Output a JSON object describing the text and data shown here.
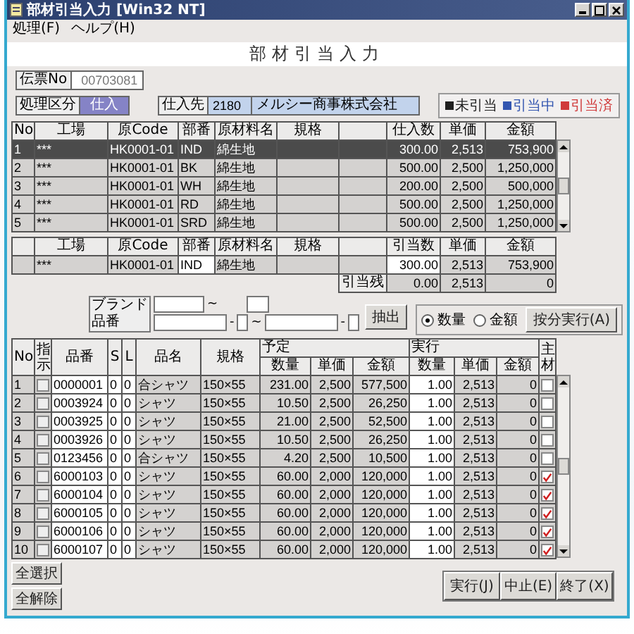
{
  "window": {
    "title": "部材引当入力 [Win32 NT]"
  },
  "menu": [
    "処理(F)",
    "ヘルプ(H)"
  ],
  "form_title": "部材引当入力",
  "slip_no": {
    "label": "伝票No",
    "value": "00703081"
  },
  "process_type": {
    "label": "処理区分",
    "value": "仕入"
  },
  "supplier": {
    "label": "仕入先",
    "code": "2180",
    "name": "メルシー商事株式会社"
  },
  "legend": [
    {
      "label": "未引当",
      "color": "#202020"
    },
    {
      "label": "引当中",
      "color": "#3356b0"
    },
    {
      "label": "引当済",
      "color": "#d03a3a"
    }
  ],
  "purchase_table": {
    "columns": [
      "No",
      "工場",
      "原Code",
      "部番",
      "原材料名",
      "規格",
      "仕入数",
      "単価",
      "金額"
    ],
    "rows": [
      {
        "no": "1",
        "factory": "***",
        "code": "HK0001-01",
        "part": "IND",
        "material": "綿生地",
        "qty": "300.00",
        "price": "2,513",
        "amount": "753,900",
        "selected": true
      },
      {
        "no": "2",
        "factory": "***",
        "code": "HK0001-01",
        "part": "BK",
        "material": "綿生地",
        "qty": "500.00",
        "price": "2,500",
        "amount": "1,250,000",
        "selected": false
      },
      {
        "no": "3",
        "factory": "***",
        "code": "HK0001-01",
        "part": "WH",
        "material": "綿生地",
        "qty": "200.00",
        "price": "2,500",
        "amount": "500,000",
        "selected": false
      },
      {
        "no": "4",
        "factory": "***",
        "code": "HK0001-01",
        "part": "RD",
        "material": "綿生地",
        "qty": "500.00",
        "price": "2,500",
        "amount": "1,250,000",
        "selected": false
      },
      {
        "no": "5",
        "factory": "***",
        "code": "HK0001-01",
        "part": "SRD",
        "material": "綿生地",
        "qty": "500.00",
        "price": "2,500",
        "amount": "1,250,000",
        "selected": false
      }
    ]
  },
  "allocation_table": {
    "columns": [
      "工場",
      "原Code",
      "部番",
      "原材料名",
      "規格",
      "引当数",
      "単価",
      "金額"
    ],
    "row": {
      "factory": "***",
      "code": "HK0001-01",
      "part": "IND",
      "material": "綿生地",
      "qty": "300.00",
      "price": "2,513",
      "amount": "753,900"
    }
  },
  "remaining": {
    "label": "引当残",
    "qty": "0.00",
    "price": "2,513",
    "amount": "0"
  },
  "filter": {
    "brand_label": "ブランド",
    "brand_sep": "~",
    "part_label": "品番",
    "part_seps": [
      "-",
      "~",
      "-"
    ]
  },
  "extract_button": "抽出",
  "mode": [
    {
      "label": "数量",
      "selected": true
    },
    {
      "label": "金額",
      "selected": false
    }
  ],
  "distribute_button": "按分実行(A)",
  "detail_table": {
    "columns": [
      "No",
      "指示",
      "品番",
      "S",
      "L",
      "品名",
      "規格"
    ],
    "plan_label": "予定",
    "exec_label": "実行",
    "plan_sub_columns": [
      "数量",
      "単価",
      "金額"
    ],
    "exec_sub_columns": [
      "数量",
      "単価",
      "金額"
    ],
    "main_label": "主材",
    "rows": [
      {
        "no": "1",
        "instructed": false,
        "part_no": "0000001",
        "s": "0",
        "l": "0",
        "name": "合シャツ",
        "spec": "150×55",
        "plan_qty": "231.00",
        "plan_price": "2,500",
        "plan_amount": "577,500",
        "exec_qty": "1.00",
        "exec_price": "2,513",
        "exec_amount": "0",
        "main_material": false
      },
      {
        "no": "2",
        "instructed": false,
        "part_no": "0003924",
        "s": "0",
        "l": "0",
        "name": "シャツ",
        "spec": "150×55",
        "plan_qty": "10.50",
        "plan_price": "2,500",
        "plan_amount": "26,250",
        "exec_qty": "1.00",
        "exec_price": "2,513",
        "exec_amount": "0",
        "main_material": false
      },
      {
        "no": "3",
        "instructed": false,
        "part_no": "0003925",
        "s": "0",
        "l": "0",
        "name": "シャツ",
        "spec": "150×55",
        "plan_qty": "21.00",
        "plan_price": "2,500",
        "plan_amount": "52,500",
        "exec_qty": "1.00",
        "exec_price": "2,513",
        "exec_amount": "0",
        "main_material": false
      },
      {
        "no": "4",
        "instructed": false,
        "part_no": "0003926",
        "s": "0",
        "l": "0",
        "name": "シャツ",
        "spec": "150×55",
        "plan_qty": "10.50",
        "plan_price": "2,500",
        "plan_amount": "26,250",
        "exec_qty": "1.00",
        "exec_price": "2,513",
        "exec_amount": "0",
        "main_material": false
      },
      {
        "no": "5",
        "instructed": false,
        "part_no": "0123456",
        "s": "0",
        "l": "0",
        "name": "合シャツ",
        "spec": "150×55",
        "plan_qty": "4.20",
        "plan_price": "2,500",
        "plan_amount": "10,500",
        "exec_qty": "1.00",
        "exec_price": "2,513",
        "exec_amount": "0",
        "main_material": false
      },
      {
        "no": "6",
        "instructed": false,
        "part_no": "6000103",
        "s": "0",
        "l": "0",
        "name": "シャツ",
        "spec": "150×55",
        "plan_qty": "60.00",
        "plan_price": "2,000",
        "plan_amount": "120,000",
        "exec_qty": "1.00",
        "exec_price": "2,513",
        "exec_amount": "0",
        "main_material": true
      },
      {
        "no": "7",
        "instructed": false,
        "part_no": "6000104",
        "s": "0",
        "l": "0",
        "name": "シャツ",
        "spec": "150×55",
        "plan_qty": "60.00",
        "plan_price": "2,000",
        "plan_amount": "120,000",
        "exec_qty": "1.00",
        "exec_price": "2,513",
        "exec_amount": "0",
        "main_material": true
      },
      {
        "no": "8",
        "instructed": false,
        "part_no": "6000105",
        "s": "0",
        "l": "0",
        "name": "シャツ",
        "spec": "150×55",
        "plan_qty": "60.00",
        "plan_price": "2,000",
        "plan_amount": "120,000",
        "exec_qty": "1.00",
        "exec_price": "2,513",
        "exec_amount": "0",
        "main_material": true
      },
      {
        "no": "9",
        "instructed": false,
        "part_no": "6000106",
        "s": "0",
        "l": "0",
        "name": "シャツ",
        "spec": "150×55",
        "plan_qty": "60.00",
        "plan_price": "2,000",
        "plan_amount": "120,000",
        "exec_qty": "1.00",
        "exec_price": "2,513",
        "exec_amount": "0",
        "main_material": true
      },
      {
        "no": "10",
        "instructed": false,
        "part_no": "6000107",
        "s": "0",
        "l": "0",
        "name": "シャツ",
        "spec": "150×55",
        "plan_qty": "60.00",
        "plan_price": "2,000",
        "plan_amount": "120,000",
        "exec_qty": "1.00",
        "exec_price": "2,513",
        "exec_amount": "0",
        "main_material": true
      }
    ]
  },
  "select_buttons": [
    "全選択",
    "全解除"
  ],
  "actions": [
    "実行(J)",
    "中止(E)",
    "終了(X)"
  ]
}
